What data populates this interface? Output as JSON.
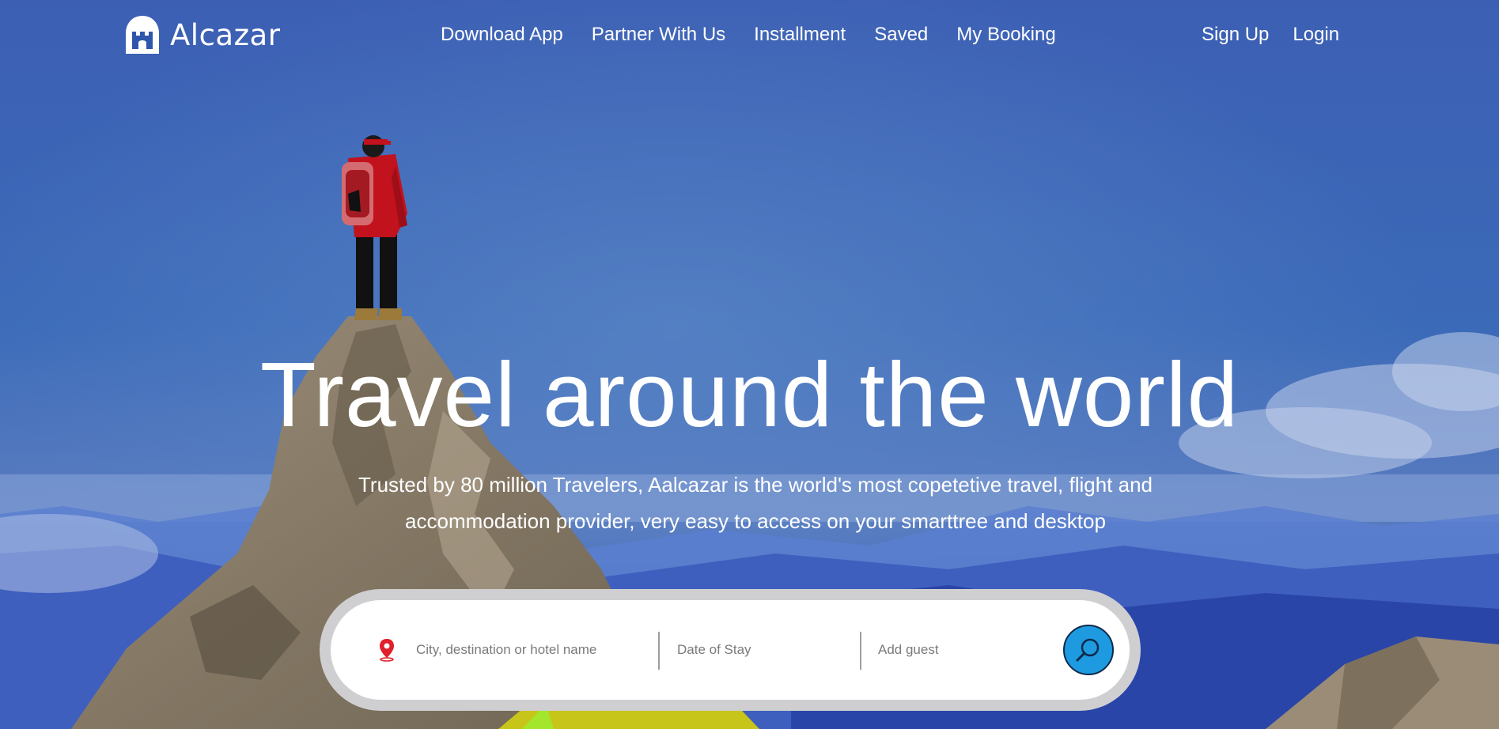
{
  "brand": {
    "name": "Alcazar"
  },
  "nav": {
    "items": [
      {
        "label": "Download App"
      },
      {
        "label": "Partner With Us"
      },
      {
        "label": "Installment"
      },
      {
        "label": "Saved"
      },
      {
        "label": "My Booking"
      }
    ],
    "auth": {
      "signup": "Sign Up",
      "login": "Login"
    }
  },
  "hero": {
    "headline": "Travel around the world",
    "subtitle": "Trusted by 80 million Travelers, Aalcazar is the world's most copetetive travel, flight and accommodation provider, very easy to access on your smarttree and desktop"
  },
  "search": {
    "destination_placeholder": "City, destination or hotel name",
    "date_placeholder": "Date of Stay",
    "guest_placeholder": "Add guest",
    "destination_value": "",
    "date_value": "",
    "guest_value": ""
  },
  "icons": {
    "logo": "castle-icon",
    "pin": "map-pin-icon",
    "search": "search-icon"
  },
  "colors": {
    "sky": "#2e56b0",
    "accent": "#1e9be0",
    "pin": "#e0202a",
    "jacket": "#c2121d",
    "rock": "#8c7f6c"
  }
}
